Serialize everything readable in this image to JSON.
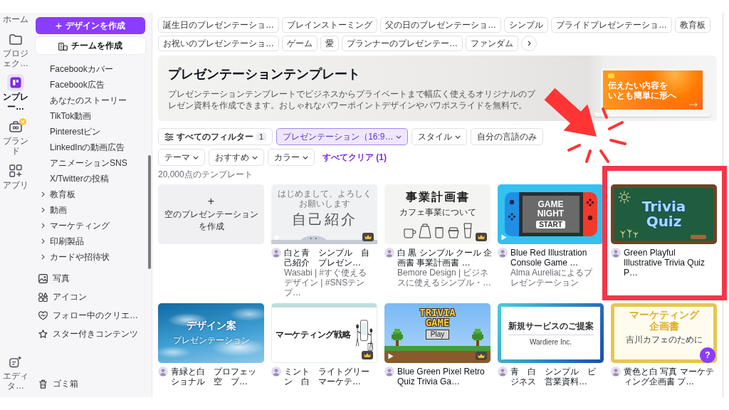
{
  "rail": {
    "items": [
      {
        "label": "ホーム",
        "selected": false,
        "badge": false
      },
      {
        "label": "プロジェク…",
        "selected": false,
        "badge": false
      },
      {
        "label": "ンプレー…",
        "selected": true,
        "badge": false
      },
      {
        "label": "ブランド",
        "selected": false,
        "badge": true
      },
      {
        "label": "アプリ",
        "selected": false,
        "badge": false
      }
    ],
    "bottom_item": {
      "label": "エディタ…"
    }
  },
  "sidebar": {
    "create_button": "デザインを作成",
    "team_button": "チームを作成",
    "menu": [
      {
        "label": "Facebookカバー",
        "kind": "subitem"
      },
      {
        "label": "Facebook広告",
        "kind": "subitem"
      },
      {
        "label": "あなたのストーリー",
        "kind": "subitem"
      },
      {
        "label": "TikTok動画",
        "kind": "subitem"
      },
      {
        "label": "Pinterestピン",
        "kind": "subitem"
      },
      {
        "label": "LinkedInの動画広告",
        "kind": "subitem"
      },
      {
        "label": "アニメーションSNS",
        "kind": "subitem"
      },
      {
        "label": "X/Twitterの投稿",
        "kind": "subitem"
      },
      {
        "label": "教育板",
        "kind": "group"
      },
      {
        "label": "動画",
        "kind": "group"
      },
      {
        "label": "マーケティング",
        "kind": "group"
      },
      {
        "label": "印刷製品",
        "kind": "group"
      },
      {
        "label": "カードや招待状",
        "kind": "group"
      }
    ],
    "nav": [
      {
        "label": "写真"
      },
      {
        "label": "アイコン"
      },
      {
        "label": "フォロー中のクリエ…"
      },
      {
        "label": "スター付きコンテンツ"
      }
    ],
    "trash": "ゴミ箱"
  },
  "chips": [
    "誕生日のプレゼンテーショ…",
    "ブレインストーミング",
    "父の日のプレゼンテーショ…",
    "シンプル",
    "プライドプレゼンテーショ…",
    "教育板",
    "お祝いのプレゼンテーショ…",
    "ゲーム",
    "愛",
    "プランナーのプレゼンテー…",
    "ファンダム"
  ],
  "banner": {
    "title": "プレゼンテーションテンプレート",
    "description": "プレゼンテーションテンプレートでビジネスからプライベートまで幅広く使えるオリジナルのプレゼン資料を作成できます。おしゃれなパワーポイントデザインやパワポスライドを無料で。",
    "screen_lines": [
      "伝えたい内容を",
      "いとも簡単に形へ"
    ]
  },
  "filters": [
    {
      "kind": "all-filters",
      "label": "すべてのフィルター",
      "count": "1",
      "selected": false
    },
    {
      "kind": "dropdown",
      "label": "プレゼンテーション（16:9…",
      "selected": true
    },
    {
      "kind": "dropdown",
      "label": "スタイル",
      "selected": false
    },
    {
      "kind": "toggle",
      "label": "自分の言語のみ",
      "selected": false
    },
    {
      "kind": "dropdown",
      "label": "テーマ",
      "selected": false
    },
    {
      "kind": "dropdown",
      "label": "おすすめ",
      "selected": false
    },
    {
      "kind": "dropdown",
      "label": "カラー",
      "selected": false
    },
    {
      "kind": "link",
      "label": "すべてクリア (1)",
      "selected": false
    }
  ],
  "result_count": "20,000点のテンプレート",
  "templates": [
    {
      "kind": "blank",
      "texts": [
        "+",
        "空のプレゼンテーションを作成"
      ],
      "animated": false,
      "premium": false,
      "highlighted": false,
      "arrow": false
    },
    {
      "kind": "intro",
      "texts": [
        "はじめまして、よろしくお願いします",
        "自己紹介"
      ],
      "title": "白と青　シンプル　自己紹介　プレゼン…",
      "subtitle": "Wasabi | #すぐ使えるデザイン | #SNSテンプ…",
      "animated": true,
      "premium": true,
      "highlighted": false,
      "arrow": false
    },
    {
      "kind": "business-plan",
      "texts": [
        "事業計画書",
        "カフェ事業について"
      ],
      "title": "白 黒 シンプル クール 企画書 事業計画書 …",
      "subtitle": "Bemore Design | ビジネスに使えるシンプル・…",
      "animated": false,
      "premium": true,
      "highlighted": false,
      "arrow": false
    },
    {
      "kind": "console",
      "texts": [
        "GAME",
        "NIGHT",
        "START"
      ],
      "title": "Blue Red Illustration Console Game …",
      "subtitle": "Alma Aureliaによるプレゼンテーション",
      "animated": true,
      "premium": false,
      "highlighted": false,
      "arrow": false
    },
    {
      "kind": "chalkboard",
      "texts": [
        "Trivia",
        "Quiz"
      ],
      "title": "Green Playful Illustrative Trivia Quiz P…",
      "animated": false,
      "premium": false,
      "highlighted": true,
      "arrow": true
    },
    {
      "kind": "sky",
      "texts": [
        "デザイン案",
        "プレゼンテーション"
      ],
      "title": "青緑と白　プロフェッショナル　空　プ…",
      "animated": false,
      "premium": false,
      "highlighted": false,
      "arrow": false
    },
    {
      "kind": "marketing",
      "texts": [
        "マーケティング戦略"
      ],
      "title": "ミント　ライトグリーン　白　マーケテ…",
      "animated": false,
      "premium": true,
      "highlighted": false,
      "arrow": false
    },
    {
      "kind": "pixel-game",
      "texts": [
        "TRIVIA",
        "GAME",
        "Play"
      ],
      "title": "Blue Green Pixel Retro Quiz Trivia Ga…",
      "animated": true,
      "premium": true,
      "highlighted": false,
      "arrow": false
    },
    {
      "kind": "proposal",
      "texts": [
        "新規サービスのご提案",
        "Wardiere Inc."
      ],
      "title": "青　白　シンプル　ビジネス　営業資料…",
      "animated": false,
      "premium": false,
      "highlighted": false,
      "arrow": false
    },
    {
      "kind": "yellow-plan",
      "texts": [
        "マーケティング",
        "企画書",
        "吉川カフェのために"
      ],
      "title": "黄色と白 写真 マーケティング企画書 プ…",
      "animated": false,
      "premium": false,
      "highlighted": false,
      "arrow": false
    }
  ],
  "help_button": "?"
}
